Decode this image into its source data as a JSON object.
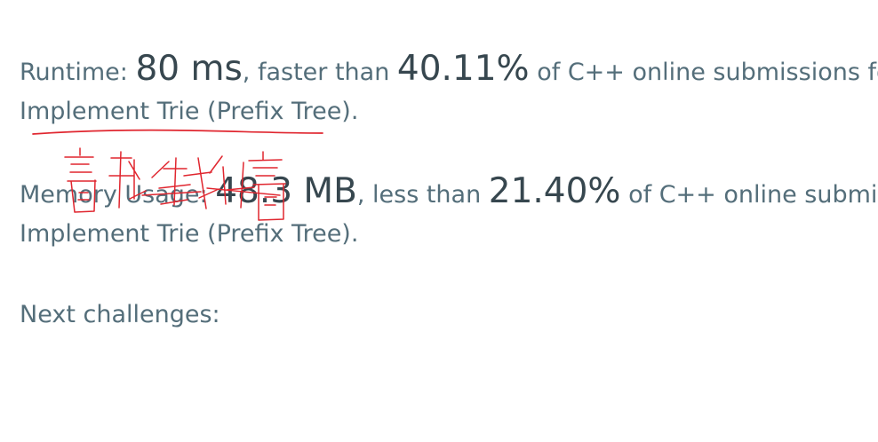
{
  "runtime": {
    "label": "Runtime: ",
    "value": "80 ms",
    "faster_prefix": ", faster than ",
    "percent": "40.11%",
    "suffix": " of C++ online submissions for",
    "problem": "Implement Trie (Prefix Tree)."
  },
  "memory": {
    "label": "Memory Usage: ",
    "value": "48.3 MB",
    "less_prefix": ", less than ",
    "percent": "21.40%",
    "suffix": " of C++ online submissions for",
    "problem": "Implement Trie (Prefix Tree)."
  },
  "next": {
    "label": "Next challenges:"
  },
  "annotation": {
    "color": "#e0262f"
  }
}
